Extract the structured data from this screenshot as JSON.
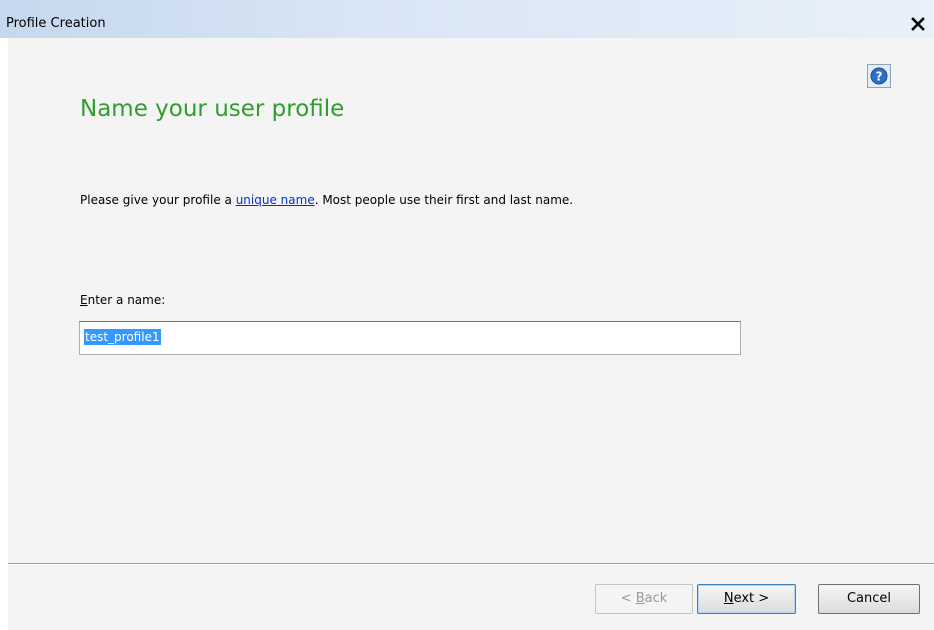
{
  "window": {
    "title": "Profile Creation"
  },
  "page": {
    "heading": "Name your user profile",
    "description_before": "Please give your profile a ",
    "description_link": "unique name",
    "description_after": ".  Most people use their first and last name.",
    "field_label_mnemonic": "E",
    "field_label_rest": "nter a name:",
    "field_value": "test_profile1"
  },
  "buttons": {
    "back_prefix": "< ",
    "back_mnemonic": "B",
    "back_rest": "ack",
    "next_mnemonic": "N",
    "next_rest": "ext >",
    "cancel": "Cancel"
  },
  "icons": {
    "close": "close-icon",
    "help": "help-icon"
  },
  "colors": {
    "heading": "#2e9e2e",
    "link": "#0033cc",
    "selection": "#3399ff"
  }
}
